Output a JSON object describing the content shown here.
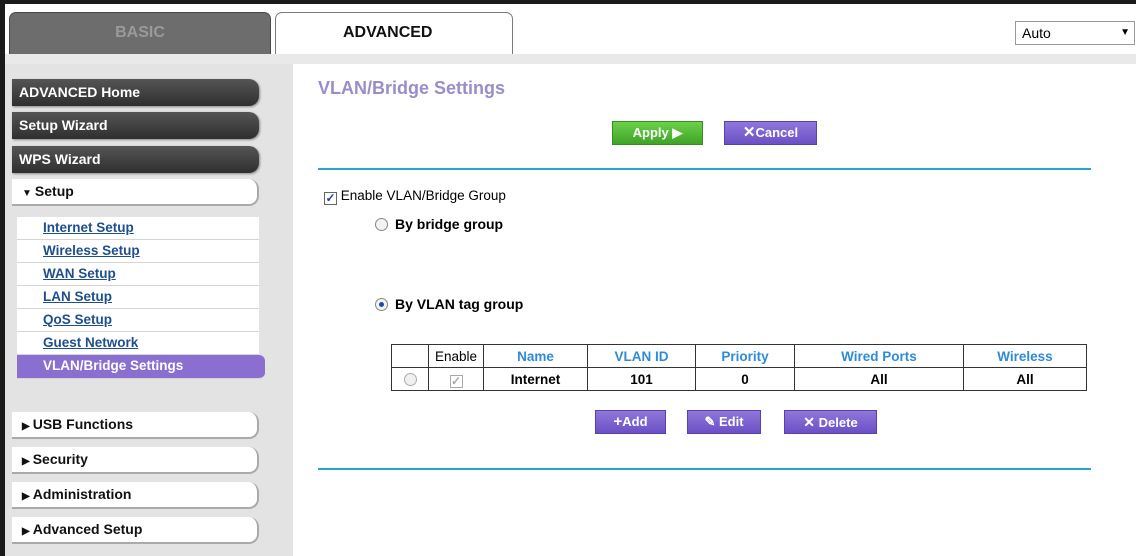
{
  "tabs": {
    "basic": "BASIC",
    "advanced": "ADVANCED"
  },
  "language": {
    "selected": "Auto"
  },
  "sidebar": {
    "advanced_home": "ADVANCED Home",
    "setup_wizard": "Setup Wizard",
    "wps_wizard": "WPS Wizard",
    "setup": "Setup",
    "setup_items": [
      "Internet Setup",
      "Wireless Setup",
      "WAN Setup",
      "LAN Setup",
      "QoS Setup",
      "Guest Network",
      "VLAN/Bridge Settings"
    ],
    "usb_functions": "USB Functions",
    "security": "Security",
    "administration": "Administration",
    "advanced_setup": "Advanced Setup"
  },
  "main": {
    "title": "VLAN/Bridge Settings",
    "apply_label": "Apply ▶",
    "cancel_label": "Cancel",
    "enable_group_label": "Enable VLAN/Bridge Group",
    "enable_group_checked": true,
    "by_bridge_label": "By bridge group",
    "by_vlan_label": "By VLAN tag group",
    "selected_mode": "vlan",
    "table": {
      "headers": [
        "Enable",
        "Name",
        "VLAN ID",
        "Priority",
        "Wired Ports",
        "Wireless"
      ],
      "rows": [
        {
          "enable": true,
          "name": "Internet",
          "vlan_id": "101",
          "priority": "0",
          "wired_ports": "All",
          "wireless": "All"
        }
      ]
    },
    "add_label": "Add",
    "edit_label": "Edit",
    "delete_label": "Delete"
  },
  "colors": {
    "accent_purple": "#7a5fd0",
    "apply_green": "#4fb832",
    "title_lavender": "#9a8dc8",
    "header_blue": "#2f8bd8",
    "divider_blue": "#2da1cf"
  }
}
